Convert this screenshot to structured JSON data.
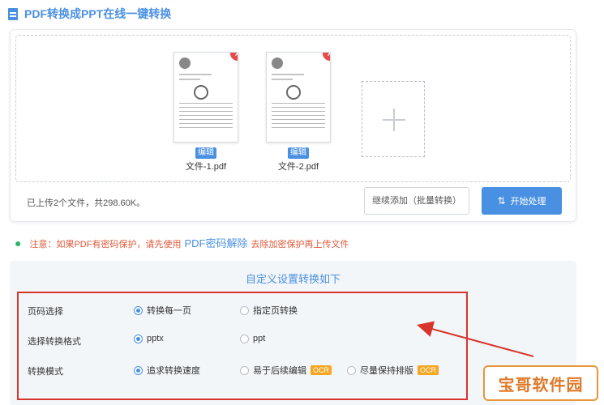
{
  "header": {
    "title": "PDF转换成PPT在线一键转换",
    "icon": "document-icon"
  },
  "files": [
    {
      "name": "文件-1.pdf",
      "edit_label": "编辑"
    },
    {
      "name": "文件-2.pdf",
      "edit_label": "编辑"
    }
  ],
  "upload": {
    "status": "已上传2个文件，共298.60K。",
    "continue_label": "继续添加（批量转换）",
    "start_label": "开始处理"
  },
  "notice": {
    "prefix": "注意：如果PDF有密码保护，请先使用",
    "link": "PDF密码解除",
    "suffix": "去除加密保护再上传文件"
  },
  "settings": {
    "title": "自定义设置转换如下",
    "rows": [
      {
        "label": "页码选择",
        "options": [
          {
            "label": "转换每一页",
            "selected": true
          },
          {
            "label": "指定页转换",
            "selected": false
          }
        ]
      },
      {
        "label": "选择转换格式",
        "options": [
          {
            "label": "pptx",
            "selected": true
          },
          {
            "label": "ppt",
            "selected": false
          }
        ]
      },
      {
        "label": "转换模式",
        "options": [
          {
            "label": "追求转换速度",
            "selected": true
          },
          {
            "label": "易于后续编辑",
            "selected": false,
            "badge": "OCR"
          },
          {
            "label": "尽量保持排版",
            "selected": false,
            "badge": "OCR"
          }
        ]
      }
    ]
  },
  "watermark": "宝哥软件园",
  "colors": {
    "primary": "#4a90e2",
    "danger": "#e84a4a",
    "highlight": "#d9342b",
    "badge": "#f5a623"
  }
}
